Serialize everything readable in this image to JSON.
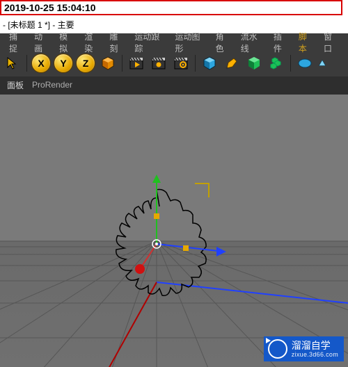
{
  "timestamp": "2019-10-25 15:04:10",
  "titlebar": "- [未标题 1 *] - 主要",
  "menu": {
    "items": [
      "捕捉",
      "动画",
      "模拟",
      "渲染",
      "雕刻",
      "运动跟踪",
      "运动图形",
      "角色",
      "流水线",
      "插件",
      "脚本",
      "窗口"
    ],
    "highlight_index": 10
  },
  "toolbar": {
    "select_arrow": "select",
    "axis_x": "X",
    "axis_y": "Y",
    "axis_z": "Z",
    "cube_tool": "cube",
    "clapper_a": "render-frame",
    "clapper_b": "render-seq",
    "clapper_gear": "render-settings",
    "cube_prim": "cube-prim",
    "pen_tool": "pen",
    "light_prim": "light",
    "tube_prim": "array",
    "ellipse_prim": "ellipse",
    "tri_prim": "tri"
  },
  "tabs": {
    "items": [
      "面板",
      "ProRender"
    ],
    "active_index": 0
  },
  "watermark": {
    "main": "溜溜自学",
    "sub": "zixue.3d66.com"
  }
}
